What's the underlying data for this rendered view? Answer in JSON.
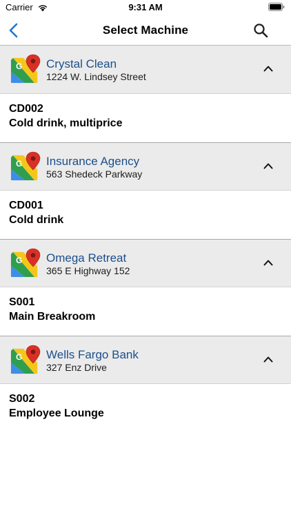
{
  "status_bar": {
    "carrier": "Carrier",
    "time": "9:31 AM",
    "wifi_icon": "wifi-icon",
    "battery_icon": "battery-icon"
  },
  "nav": {
    "title": "Select Machine",
    "back_icon": "chevron-left-icon",
    "search_icon": "search-icon",
    "accent_color": "#1b77d2"
  },
  "groups": [
    {
      "name": "Crystal Clean",
      "address": "1224 W. Lindsey Street",
      "machines": [
        {
          "code": "CD002",
          "description": "Cold drink, multiprice"
        }
      ]
    },
    {
      "name": "Insurance Agency",
      "address": "563 Shedeck Parkway",
      "machines": [
        {
          "code": "CD001",
          "description": "Cold drink"
        }
      ]
    },
    {
      "name": "Omega Retreat",
      "address": "365 E Highway 152",
      "machines": [
        {
          "code": "S001",
          "description": "Main Breakroom"
        }
      ]
    },
    {
      "name": "Wells Fargo Bank",
      "address": "327 Enz Drive",
      "machines": [
        {
          "code": "S002",
          "description": "Employee Lounge"
        }
      ]
    }
  ],
  "colors": {
    "location_name": "#1b4f8a",
    "header_background": "#ebebeb"
  }
}
